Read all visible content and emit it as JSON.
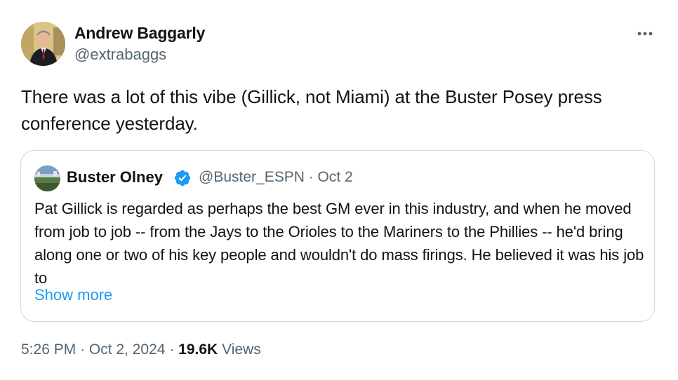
{
  "author": {
    "name": "Andrew Baggarly",
    "handle": "@extrabaggs"
  },
  "tweet_text": "There was a lot of this vibe (Gillick, not Miami) at the Buster Posey press conference yesterday.",
  "quoted_tweet": {
    "name": "Buster Olney",
    "handle_date": "@Buster_ESPN · Oct 2",
    "text": "Pat Gillick is regarded as perhaps the best GM ever in this industry, and when he moved from job to job -- from the Jays to the Orioles to the Mariners to the Phillies -- he'd bring along one or two of his key people and wouldn't do mass firings. He believed it was his job to",
    "show_more": "Show more"
  },
  "meta": {
    "time": "5:26 PM",
    "separator": "·",
    "date": "Oct 2, 2024",
    "views_count": "19.6K",
    "views_label": "Views"
  },
  "icons": {
    "more": "more-horizontal-icon",
    "verified": "verified-badge-icon"
  },
  "colors": {
    "text": "#0f1419",
    "secondary": "#536471",
    "link": "#1d9bf0",
    "border": "#cfd9de",
    "verified": "#1d9bf0"
  }
}
